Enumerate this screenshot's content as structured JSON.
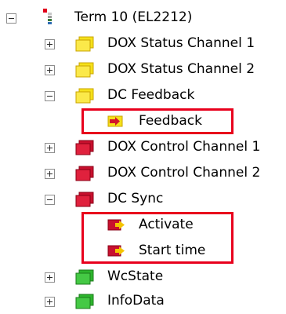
{
  "tree": {
    "root": {
      "label": "Term 10 (EL2212)",
      "expanded": true,
      "icon": "terminal-icon"
    },
    "nodes": [
      {
        "label": "DOX Status Channel 1",
        "icon": "input-folder-icon",
        "expander": "plus"
      },
      {
        "label": "DOX Status Channel 2",
        "icon": "input-folder-icon",
        "expander": "plus"
      },
      {
        "label": "DC Feedback",
        "icon": "input-folder-icon",
        "expander": "minus",
        "children": [
          {
            "label": "Feedback",
            "icon": "input-variable-icon",
            "highlighted": true
          }
        ]
      },
      {
        "label": "DOX Control Channel 1",
        "icon": "output-folder-icon",
        "expander": "plus"
      },
      {
        "label": "DOX Control Channel 2",
        "icon": "output-folder-icon",
        "expander": "plus"
      },
      {
        "label": "DC Sync",
        "icon": "output-folder-icon",
        "expander": "minus",
        "children": [
          {
            "label": "Activate",
            "icon": "output-variable-icon",
            "highlighted": true
          },
          {
            "label": "Start time",
            "icon": "output-variable-icon",
            "highlighted": true
          }
        ]
      },
      {
        "label": "WcState",
        "icon": "status-folder-icon",
        "expander": "plus"
      },
      {
        "label": "InfoData",
        "icon": "status-folder-icon",
        "expander": "plus"
      }
    ]
  },
  "colors": {
    "input_folder": "#f5e11a",
    "output_folder": "#c8102e",
    "status_folder": "#2db52d",
    "highlight_border": "#e8001c"
  }
}
